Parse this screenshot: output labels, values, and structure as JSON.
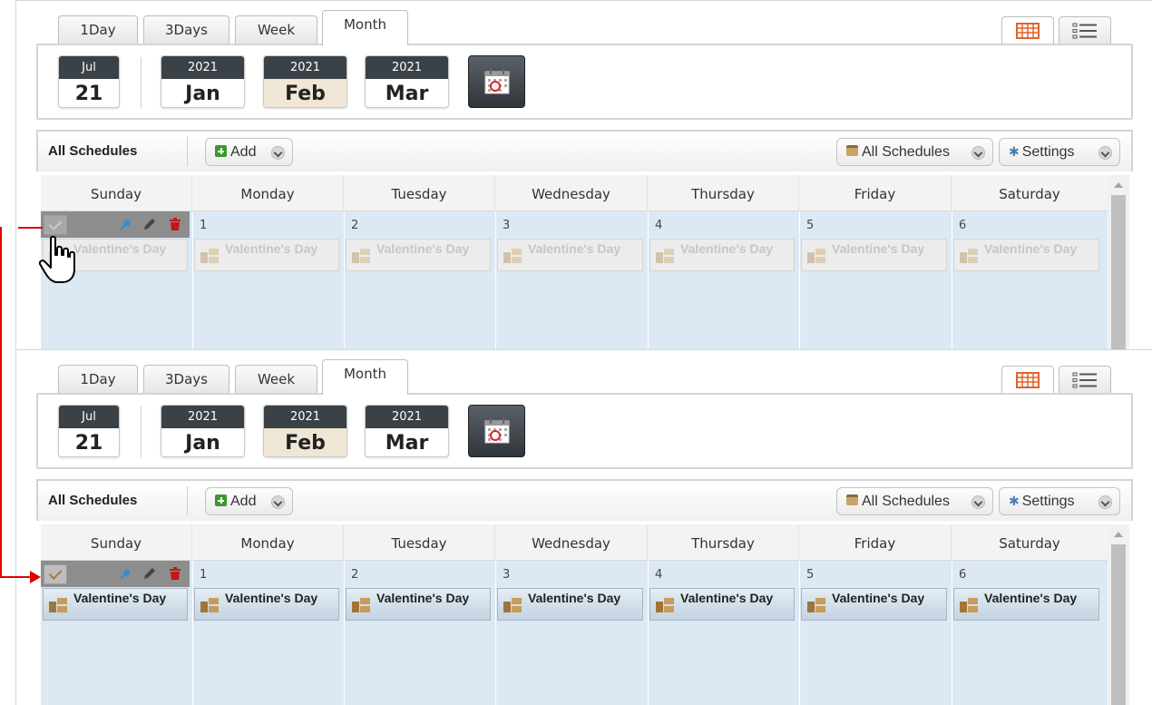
{
  "tabs": [
    "1Day",
    "3Days",
    "Week",
    "Month"
  ],
  "active_tab": "Month",
  "today": {
    "month": "Jul",
    "day": "21"
  },
  "months": [
    {
      "year": "2021",
      "name": "Jan"
    },
    {
      "year": "2021",
      "name": "Feb"
    },
    {
      "year": "2021",
      "name": "Mar"
    }
  ],
  "selected_month": "Feb",
  "toolbar": {
    "title": "All Schedules",
    "add_label": "Add",
    "schedules_label": "All Schedules",
    "settings_label": "Settings"
  },
  "weekdays": [
    "Sunday",
    "Monday",
    "Tuesday",
    "Wednesday",
    "Thursday",
    "Friday",
    "Saturday"
  ],
  "day_numbers": [
    "1",
    "2",
    "3",
    "4",
    "5",
    "6"
  ],
  "event_title": "Valentine's Day",
  "colors": {
    "accent_orange": "#e0622a",
    "header_dark": "#3a4147",
    "selected_month_bg": "#efe6d6",
    "grid_bg": "#dce9f5",
    "connector": "#e00000"
  },
  "icons": [
    "grid-view-icon",
    "list-view-icon",
    "calendar-icon",
    "check-icon",
    "pin-icon",
    "pencil-icon",
    "trash-icon",
    "pointer-hand-icon"
  ]
}
